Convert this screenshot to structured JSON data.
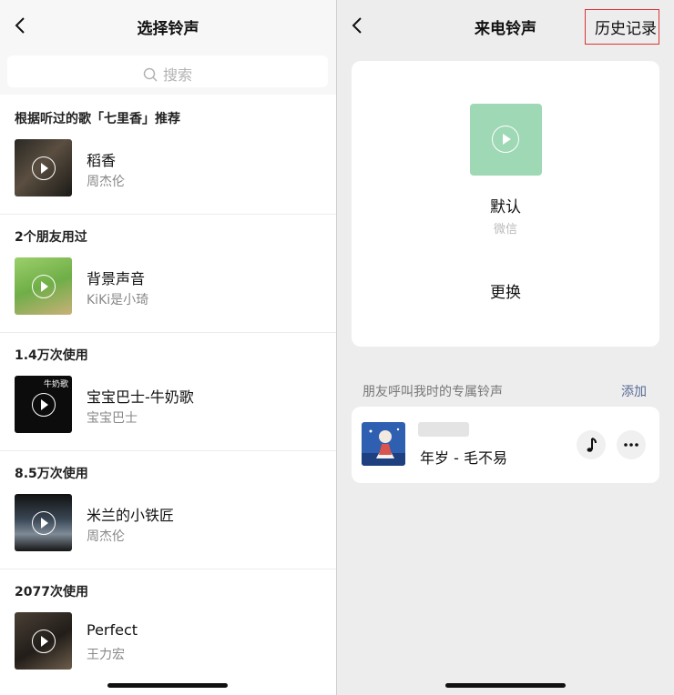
{
  "left": {
    "title": "选择铃声",
    "search_placeholder": "搜索",
    "sections": [
      {
        "header": "根据听过的歌「七里香」推荐",
        "song": "稻香",
        "artist": "周杰伦"
      },
      {
        "header": "2个朋友用过",
        "song": "背景声音",
        "artist": "KiKi是小琦"
      },
      {
        "header": "1.4万次使用",
        "song": "宝宝巴士-牛奶歌",
        "artist": "宝宝巴士",
        "cover_text": "牛奶歌"
      },
      {
        "header": "8.5万次使用",
        "song": "米兰的小铁匠",
        "artist": "周杰伦"
      },
      {
        "header": "2077次使用",
        "song": "Perfect",
        "artist": "王力宏"
      }
    ]
  },
  "right": {
    "title": "来电铃声",
    "history_button": "历史记录",
    "current": {
      "name": "默认",
      "source": "微信",
      "change_label": "更换"
    },
    "friends_label": "朋友呼叫我时的专属铃声",
    "add_label": "添加",
    "ringtone": {
      "title": "年岁 - 毛不易"
    }
  },
  "colors": {
    "accent_link": "#576b95",
    "default_cover": "#9fd8b5",
    "highlight_box": "#dd3333"
  }
}
